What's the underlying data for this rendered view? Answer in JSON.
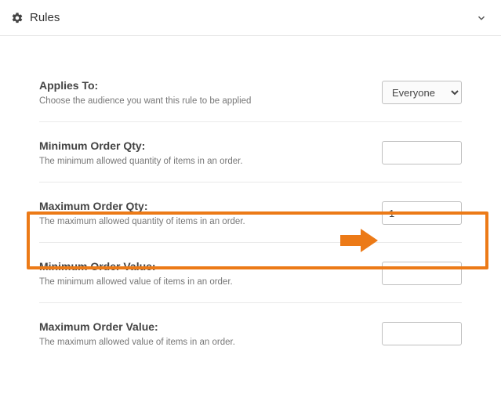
{
  "header": {
    "title": "Rules"
  },
  "rows": {
    "appliesTo": {
      "label": "Applies To:",
      "desc": "Choose the audience you want this rule to be applied",
      "selected": "Everyone"
    },
    "minQty": {
      "label": "Minimum Order Qty:",
      "desc": "The minimum allowed quantity of items in an order.",
      "value": ""
    },
    "maxQty": {
      "label": "Maximum Order Qty:",
      "desc": "The maximum allowed quantity of items in an order.",
      "value": "1"
    },
    "minValue": {
      "label": "Minimum Order Value:",
      "desc": "The minimum allowed value of items in an order.",
      "value": ""
    },
    "maxValue": {
      "label": "Maximum Order Value:",
      "desc": "The maximum allowed value of items in an order.",
      "value": ""
    }
  },
  "annotation": {
    "highlight_color": "#ec7a17"
  }
}
